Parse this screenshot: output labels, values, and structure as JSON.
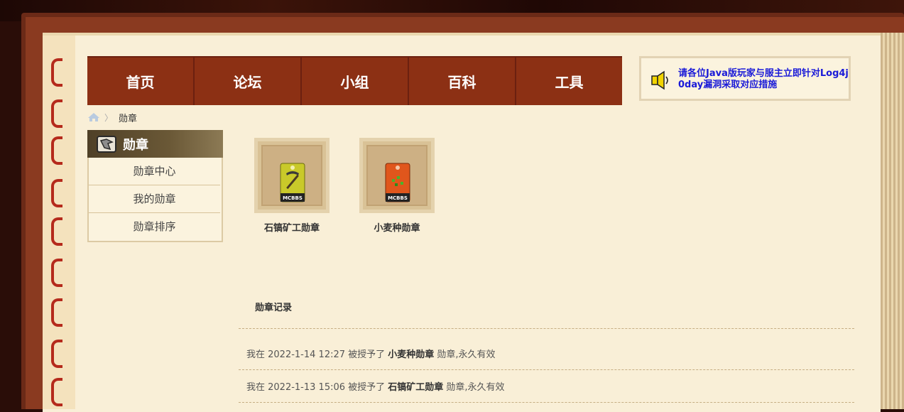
{
  "nav": {
    "items": [
      "首页",
      "论坛",
      "小组",
      "百科",
      "工具"
    ]
  },
  "notice": {
    "text": "请各位Java版玩家与服主立即针对Log4j 0day漏洞采取对应措施",
    "icon": "speaker-icon"
  },
  "breadcrumb": {
    "current": "勋章",
    "separator": "〉"
  },
  "sidebar": {
    "title": "勋章",
    "items": [
      {
        "label": "勋章中心"
      },
      {
        "label": "我的勋章"
      },
      {
        "label": "勋章排序"
      }
    ]
  },
  "badges": [
    {
      "name": "石镐矿工勋章",
      "color": "#c9c92a",
      "icon": "pickaxe-badge-icon",
      "logo_text": "MCBBS"
    },
    {
      "name": "小麦种勋章",
      "color": "#e0561c",
      "icon": "wheat-seed-badge-icon",
      "logo_text": "MCBBS"
    }
  ],
  "records": {
    "title": "勋章记录",
    "rows": [
      {
        "prefix": "我在 2022-1-14 12:27 被授予了 ",
        "badge": "小麦种勋章",
        "suffix": " 勋章,永久有效"
      },
      {
        "prefix": "我在 2022-1-13 15:06 被授予了 ",
        "badge": "石镐矿工勋章",
        "suffix": " 勋章,永久有效"
      }
    ]
  }
}
